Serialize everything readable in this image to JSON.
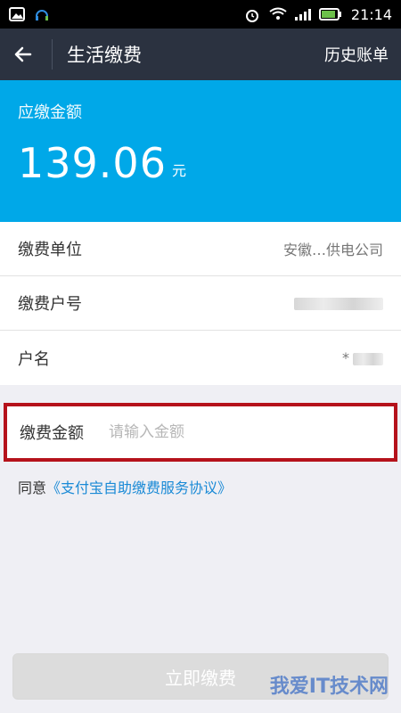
{
  "status_bar": {
    "time": "21:14"
  },
  "header": {
    "title": "生活缴费",
    "action_label": "历史账单"
  },
  "summary": {
    "label": "应缴金额",
    "amount": "139.06",
    "unit": "元"
  },
  "info_rows": [
    {
      "label": "缴费单位",
      "value": "安徽…供电公司"
    },
    {
      "label": "缴费户号",
      "value": ""
    },
    {
      "label": "户名",
      "value": "*"
    }
  ],
  "amount_input": {
    "label": "缴费金额",
    "placeholder": "请输入金额",
    "value": ""
  },
  "agreement": {
    "prefix": "同意",
    "link_text": "《支付宝自助缴费服务协议》"
  },
  "submit": {
    "label": "立即缴费"
  },
  "watermark": {
    "text": "我爱IT技术网"
  }
}
